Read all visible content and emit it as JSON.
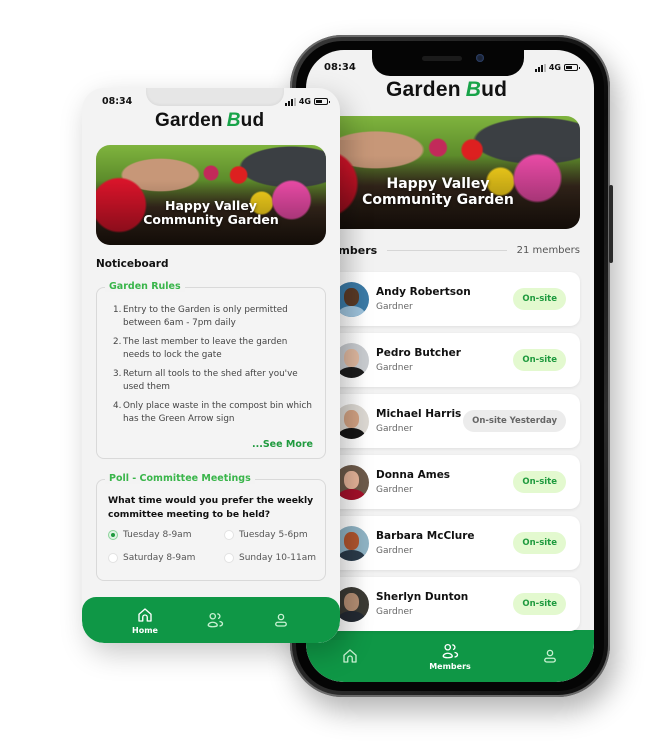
{
  "app": {
    "brand_prefix": "Garden",
    "brand_b": "B",
    "brand_suffix": "ud",
    "status": {
      "time": "08:34",
      "network": "4G"
    }
  },
  "banner": {
    "line1": "Happy Valley",
    "line2": "Community Garden"
  },
  "home_screen": {
    "noticeboard_title": "Noticeboard",
    "garden_rules": {
      "title": "Garden Rules",
      "items": [
        {
          "num": "1.",
          "text": "Entry to the Garden is only permitted between 6am - 7pm daily"
        },
        {
          "num": "2.",
          "text": "The last member to leave the garden needs to  lock the gate"
        },
        {
          "num": "3.",
          "text": "Return all tools to the shed after you've used them"
        },
        {
          "num": "4.",
          "text": "Only place waste in the compost bin which has the Green Arrow sign"
        }
      ],
      "see_more": "...See More"
    },
    "poll": {
      "title": "Poll - Committee Meetings",
      "question": "What time would you prefer the weekly committee meeting to be held?",
      "options": [
        {
          "label": "Tuesday 8-9am",
          "selected": true
        },
        {
          "label": "Tuesday 5-6pm",
          "selected": false
        },
        {
          "label": "Saturday 8-9am",
          "selected": false
        },
        {
          "label": "Sunday 10-11am",
          "selected": false
        }
      ]
    },
    "nav": [
      {
        "label": "Home",
        "icon": "home-icon",
        "active": true
      },
      {
        "label": "",
        "icon": "members-icon",
        "active": false
      },
      {
        "label": "",
        "icon": "profile-icon",
        "active": false
      }
    ]
  },
  "members_screen": {
    "title": "Members",
    "count": "21 members",
    "members": [
      {
        "name": "Andy Robertson",
        "role": "Gardner",
        "status": "On-site",
        "status_type": "onsite"
      },
      {
        "name": "Pedro Butcher",
        "role": "Gardner",
        "status": "On-site",
        "status_type": "onsite"
      },
      {
        "name": "Michael Harris",
        "role": "Gardner",
        "status": "On-site Yesterday",
        "status_type": "yesterday"
      },
      {
        "name": "Donna Ames",
        "role": "Gardner",
        "status": "On-site",
        "status_type": "onsite"
      },
      {
        "name": "Barbara McClure",
        "role": "Gardner",
        "status": "On-site",
        "status_type": "onsite"
      },
      {
        "name": "Sherlyn Dunton",
        "role": "Gardner",
        "status": "On-site",
        "status_type": "onsite"
      }
    ],
    "nav": [
      {
        "label": "",
        "icon": "home-icon",
        "active": false
      },
      {
        "label": "Members",
        "icon": "members-icon",
        "active": true
      },
      {
        "label": "",
        "icon": "profile-icon",
        "active": false
      }
    ]
  },
  "colors": {
    "brand_green": "#0f9746",
    "accent_green": "#39b54a",
    "onsite_badge_bg": "#e3f9cf",
    "onsite_badge_text": "#1f9a3e",
    "yesterday_badge_bg": "#ececec"
  }
}
